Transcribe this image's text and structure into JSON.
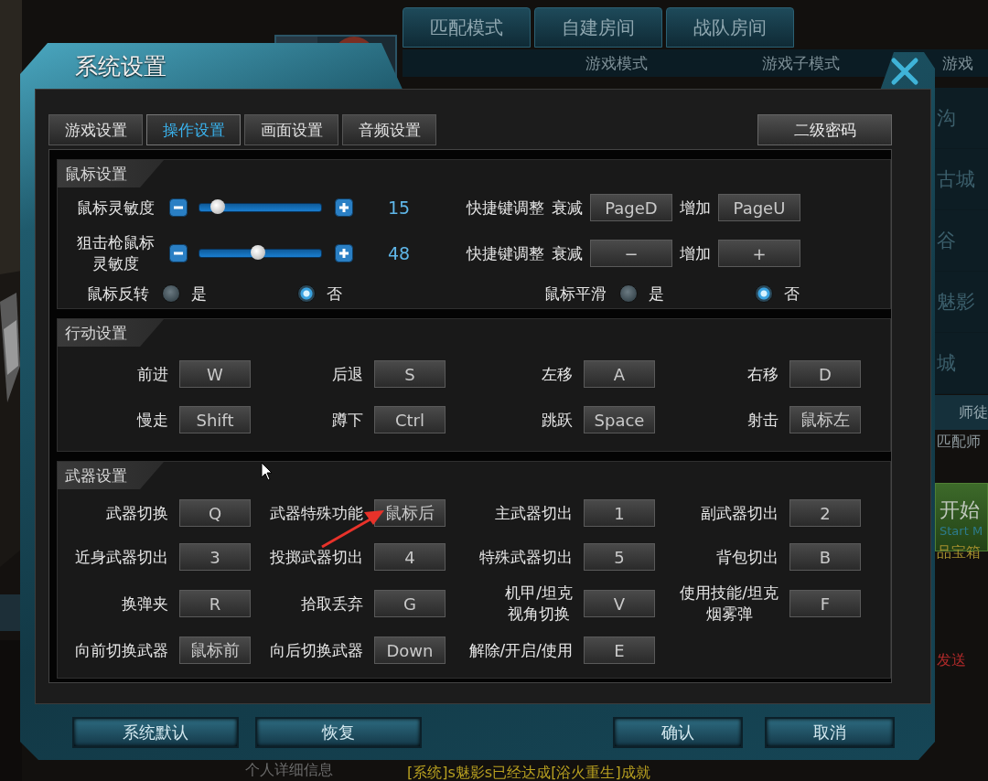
{
  "background": {
    "mode_tabs": [
      {
        "label": "匹配模式"
      },
      {
        "label": "自建房间"
      },
      {
        "label": "战队房间"
      }
    ],
    "columns": [
      "游戏模式",
      "游戏子模式",
      "游戏"
    ],
    "map_list": [
      "沟",
      "古城",
      "谷",
      "魅影",
      "城"
    ],
    "mentor_tab": "师徒",
    "mentor_text": "匹配师",
    "start_button": {
      "label": "开始",
      "sublabel": "Start M"
    },
    "chest_text": "品宝箱",
    "send_text": "发送",
    "profile_text": "个人详细信息",
    "chat_line": "[系统]s魅影s已经达成[浴火重生]成就"
  },
  "dialog": {
    "title": "系统设置",
    "tabs": [
      {
        "label": "游戏设置",
        "selected": false
      },
      {
        "label": "操作设置",
        "selected": true
      },
      {
        "label": "画面设置",
        "selected": false
      },
      {
        "label": "音频设置",
        "selected": false
      }
    ],
    "password_button": "二级密码",
    "mouse_section": {
      "title": "鼠标设置",
      "sliders": [
        {
          "label": "鼠标灵敏度",
          "level": 0.15,
          "value": "15",
          "hotkey_label": "快捷键调整",
          "decrease_label": "衰减",
          "decrease_key": "PageD",
          "increase_label": "增加",
          "increase_key": "PageU"
        },
        {
          "label_lines": [
            "狙击枪鼠标",
            "灵敏度"
          ],
          "level": 0.48,
          "value": "48",
          "hotkey_label": "快捷键调整",
          "decrease_label": "衰减",
          "decrease_key": "−",
          "increase_label": "增加",
          "increase_key": "+"
        }
      ],
      "toggles": [
        {
          "label": "鼠标反转",
          "options": [
            {
              "label": "是",
              "selected": false
            },
            {
              "label": "否",
              "selected": true
            }
          ]
        },
        {
          "label": "鼠标平滑",
          "options": [
            {
              "label": "是",
              "selected": false
            },
            {
              "label": "否",
              "selected": true
            }
          ]
        }
      ]
    },
    "action_section": {
      "title": "行动设置",
      "bindings": [
        {
          "label": "前进",
          "key": "W"
        },
        {
          "label": "后退",
          "key": "S"
        },
        {
          "label": "左移",
          "key": "A"
        },
        {
          "label": "右移",
          "key": "D"
        },
        {
          "label": "慢走",
          "key": "Shift"
        },
        {
          "label": "蹲下",
          "key": "Ctrl"
        },
        {
          "label": "跳跃",
          "key": "Space"
        },
        {
          "label": "射击",
          "key": "鼠标左"
        }
      ]
    },
    "weapon_section": {
      "title": "武器设置",
      "bindings": [
        {
          "label": "武器切换",
          "key": "Q"
        },
        {
          "label": "武器特殊功能",
          "key": "鼠标后"
        },
        {
          "label": "主武器切出",
          "key": "1"
        },
        {
          "label": "副武器切出",
          "key": "2"
        },
        {
          "label": "近身武器切出",
          "key": "3"
        },
        {
          "label": "投掷武器切出",
          "key": "4"
        },
        {
          "label": "特殊武器切出",
          "key": "5"
        },
        {
          "label": "背包切出",
          "key": "B"
        },
        {
          "label": "换弹夹",
          "key": "R"
        },
        {
          "label": "拾取丢弃",
          "key": "G"
        },
        {
          "label_lines": [
            "机甲/坦克",
            "视角切换"
          ],
          "key": "V"
        },
        {
          "label_lines": [
            "使用技能/坦克",
            "烟雾弹"
          ],
          "key": "F"
        },
        {
          "label": "向前切换武器",
          "key": "鼠标前"
        },
        {
          "label": "向后切换武器",
          "key": "Down"
        },
        {
          "label": "解除/开启/使用",
          "key": "E"
        }
      ]
    },
    "footer_left": [
      "系统默认",
      "恢复"
    ],
    "footer_right": [
      "确认",
      "取消"
    ]
  }
}
